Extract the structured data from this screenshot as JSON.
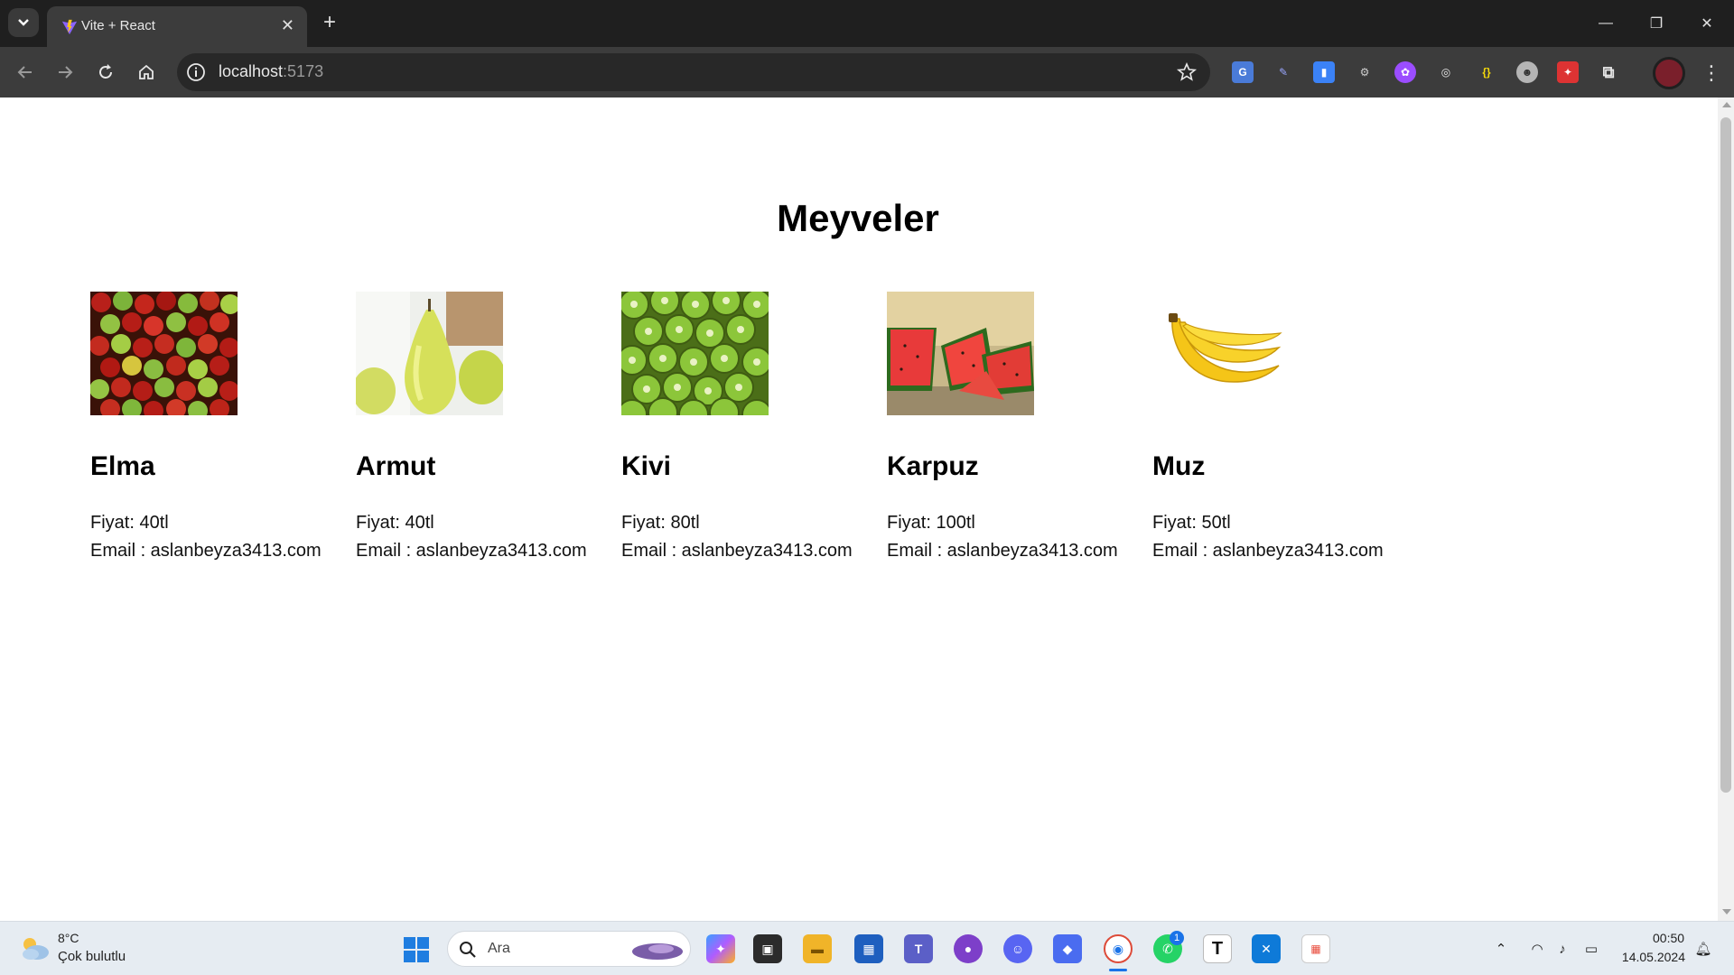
{
  "browser": {
    "tab_title": "Vite + React",
    "url_host": "localhost",
    "url_port": ":5173"
  },
  "page": {
    "title": "Meyveler",
    "fruits": [
      {
        "name": "Elma",
        "price": "Fiyat: 40tl",
        "email": "Email : aslanbeyza3413.com"
      },
      {
        "name": "Armut",
        "price": "Fiyat: 40tl",
        "email": "Email : aslanbeyza3413.com"
      },
      {
        "name": "Kivi",
        "price": "Fiyat: 80tl",
        "email": "Email : aslanbeyza3413.com"
      },
      {
        "name": "Karpuz",
        "price": "Fiyat: 100tl",
        "email": "Email : aslanbeyza3413.com"
      },
      {
        "name": "Muz",
        "price": "Fiyat: 50tl",
        "email": "Email : aslanbeyza3413.com"
      }
    ]
  },
  "taskbar": {
    "weather_temp": "8°C",
    "weather_desc": "Çok bulutlu",
    "search_placeholder": "Ara",
    "whatsapp_badge": "1",
    "clock_time": "00:50",
    "clock_date": "14.05.2024"
  },
  "colors": {
    "chrome_dark": "#1f1f1f",
    "toolbar": "#3c3c3c",
    "taskbar": "#e6ecf2"
  }
}
